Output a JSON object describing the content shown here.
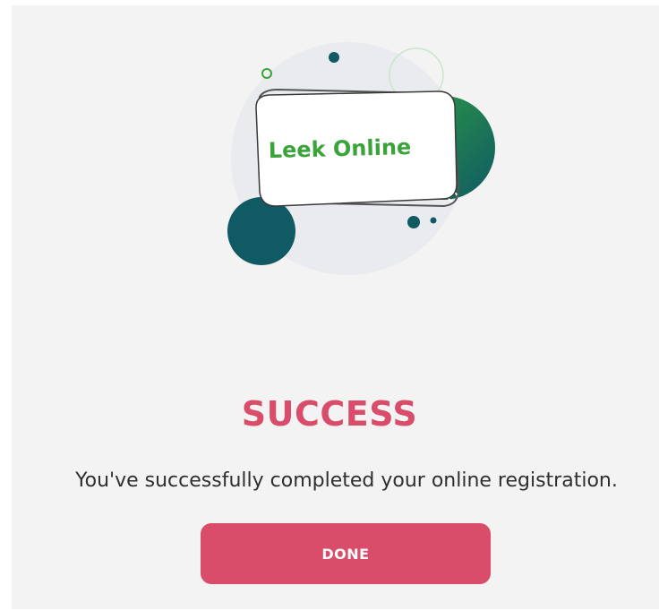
{
  "brand": {
    "name": "Leek Online"
  },
  "status": {
    "title": "SUCCESS",
    "message": "You've successfully completed your online registration."
  },
  "actions": {
    "done_label": "DONE"
  },
  "colors": {
    "accent": "#d94d6a",
    "brand_green": "#3aa33a",
    "dark_teal": "#0f5a63",
    "background": "#f3f3f3"
  },
  "icons": [
    "illustration-graphic"
  ]
}
